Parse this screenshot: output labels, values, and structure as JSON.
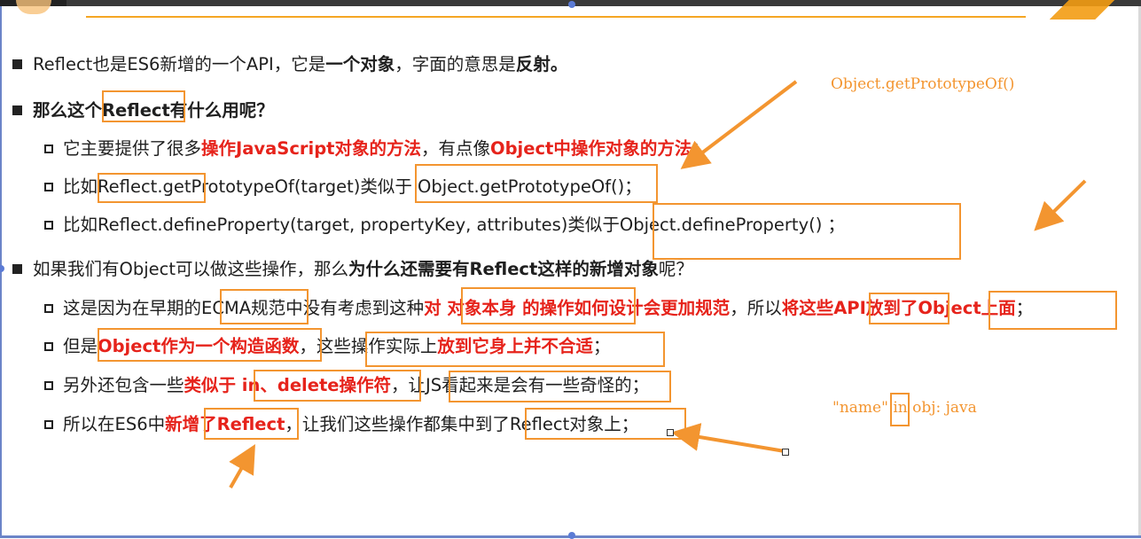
{
  "slide": {
    "line1": {
      "a": "Reflect也是ES6新增的一个API，它是",
      "b": "一个对象",
      "c": "，字面的意思是",
      "d": "反射。"
    },
    "line2": {
      "text": "那么这个Reflect有什么用呢？"
    },
    "line3": {
      "a": "它主要提供了很多",
      "b": "操作JavaScript对象的方法",
      "c": "，有点像",
      "d": "Object中操作对象的方法",
      "e": "；"
    },
    "line4": {
      "text": "比如Reflect.getPrototypeOf(target)类似于 Object.getPrototypeOf()；"
    },
    "line5": {
      "text": "比如Reflect.defineProperty(target, propertyKey, attributes)类似于Object.defineProperty() ；"
    },
    "line6": {
      "a": "如果我们有Object可以做这些操作，那么",
      "b": "为什么还需要有Reflect这样的新增对象",
      "c": "呢？"
    },
    "line7": {
      "a": "这是因为在早期的ECMA规范中没有考虑到这种",
      "b": "对 对象本身 的操作如何设计会更加规范",
      "c": "，所以",
      "d": "将这些API放到了Object上面",
      "e": "；"
    },
    "line8": {
      "a": "但是",
      "b": "Object作为一个构造函数",
      "c": "，这些操作实际上",
      "d": "放到它身上并不合适",
      "e": "；"
    },
    "line9": {
      "a": "另外还包含一些",
      "b": "类似于 in、delete操作符",
      "c": "，让JS看起来是会有一些奇怪的；"
    },
    "line10": {
      "a": "所以在ES6中",
      "b": "新增了Reflect",
      "c": "，让我们这些操作都集中到了Reflect对象上；"
    }
  },
  "annotations": {
    "note1": "Object.getPrototypeOf()",
    "note2_a": "\"name\"",
    "note2_b": "in",
    "note2_c": "obj: java"
  },
  "colors": {
    "accent": "#f39530",
    "emphasis": "#e6231b",
    "selection": "#5b7bd5"
  }
}
